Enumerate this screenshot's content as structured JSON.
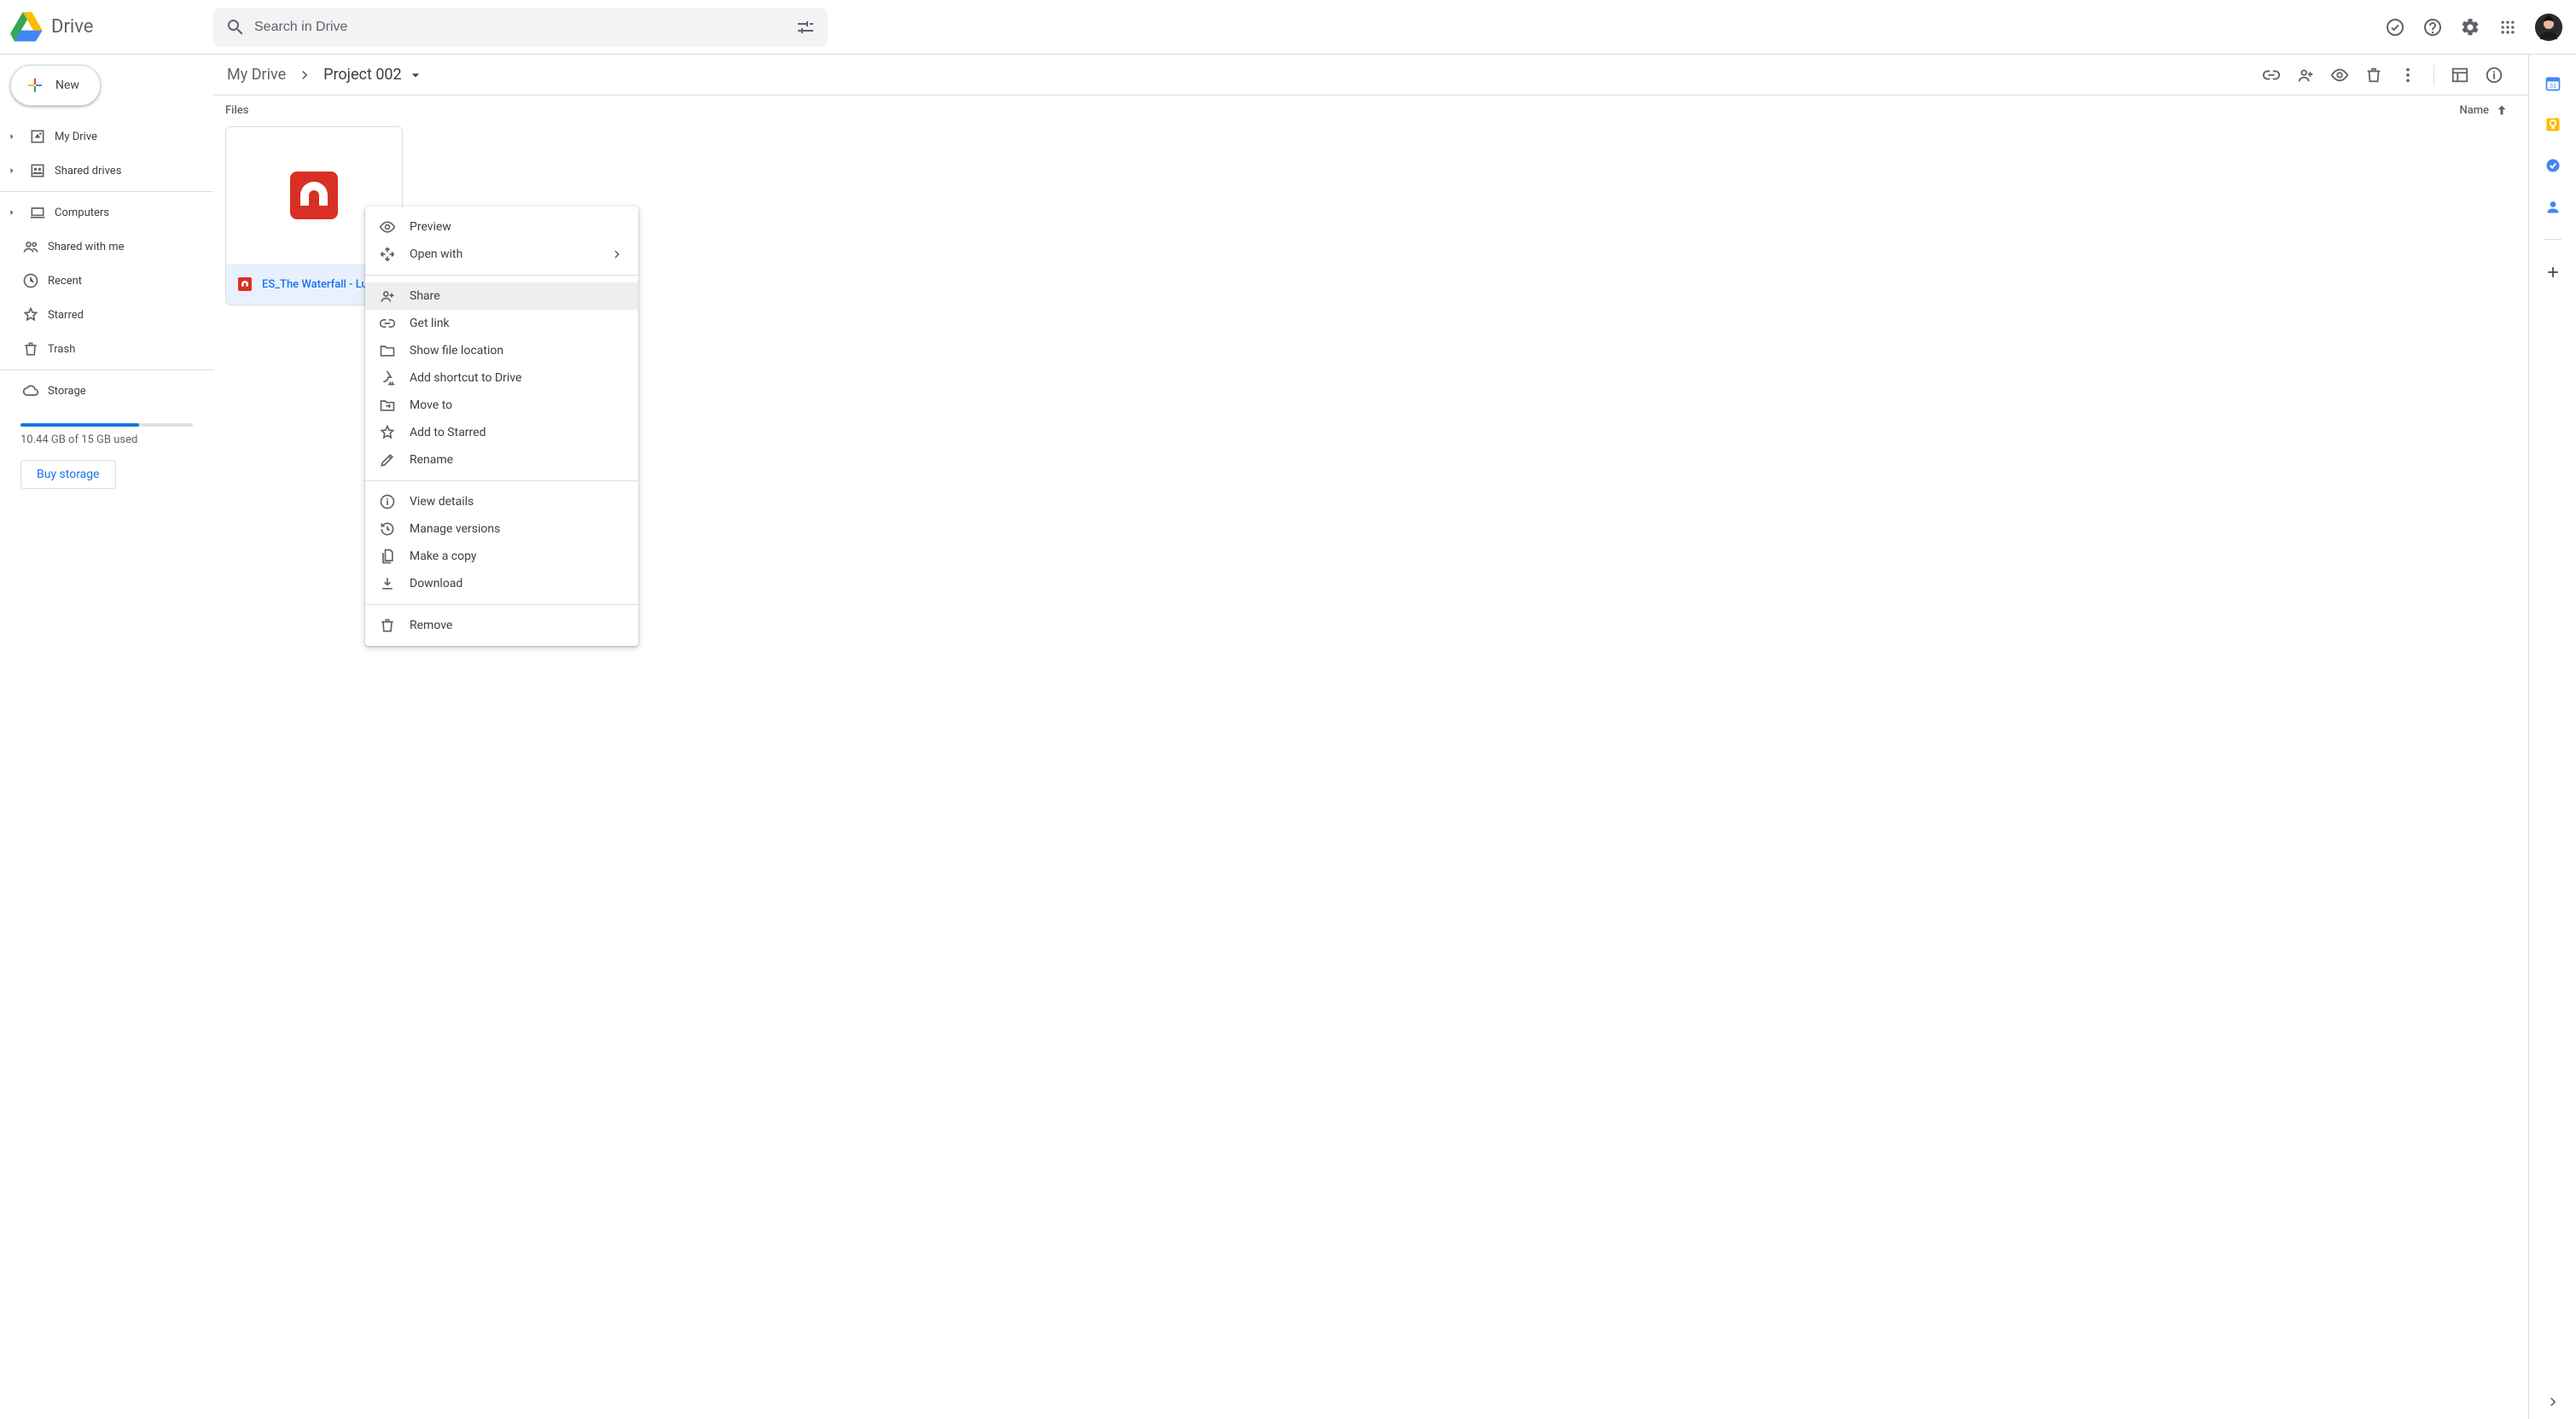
{
  "app": {
    "name": "Drive"
  },
  "search": {
    "placeholder": "Search in Drive"
  },
  "newButton": {
    "label": "New"
  },
  "sidebar": {
    "primary": [
      {
        "label": "My Drive",
        "icon": "mydrive",
        "expandable": true
      },
      {
        "label": "Shared drives",
        "icon": "shareddrives",
        "expandable": true
      }
    ],
    "secondary": [
      {
        "label": "Computers",
        "icon": "laptop",
        "expandable": true
      },
      {
        "label": "Shared with me",
        "icon": "people",
        "expandable": false
      },
      {
        "label": "Recent",
        "icon": "clock",
        "expandable": false
      },
      {
        "label": "Starred",
        "icon": "star",
        "expandable": false
      },
      {
        "label": "Trash",
        "icon": "trash",
        "expandable": false
      }
    ],
    "storage": {
      "label": "Storage",
      "usedText": "10.44 GB of 15 GB used",
      "percent": 69,
      "buyLabel": "Buy storage"
    }
  },
  "breadcrumb": {
    "root": "My Drive",
    "current": "Project 002"
  },
  "listHeader": {
    "filesLabel": "Files",
    "sortLabel": "Name"
  },
  "files": [
    {
      "name": "ES_The Waterfall - Lu",
      "selected": true
    }
  ],
  "contextMenu": {
    "groups": [
      [
        {
          "label": "Preview",
          "icon": "eye"
        },
        {
          "label": "Open with",
          "icon": "openwith",
          "submenu": true
        }
      ],
      [
        {
          "label": "Share",
          "icon": "personadd",
          "hovered": true
        },
        {
          "label": "Get link",
          "icon": "link"
        },
        {
          "label": "Show file location",
          "icon": "folder"
        },
        {
          "label": "Add shortcut to Drive",
          "icon": "shortcut"
        },
        {
          "label": "Move to",
          "icon": "moveto"
        },
        {
          "label": "Add to Starred",
          "icon": "star"
        },
        {
          "label": "Rename",
          "icon": "pencil"
        }
      ],
      [
        {
          "label": "View details",
          "icon": "info"
        },
        {
          "label": "Manage versions",
          "icon": "history"
        },
        {
          "label": "Make a copy",
          "icon": "copy"
        },
        {
          "label": "Download",
          "icon": "download"
        }
      ],
      [
        {
          "label": "Remove",
          "icon": "trash"
        }
      ]
    ]
  }
}
